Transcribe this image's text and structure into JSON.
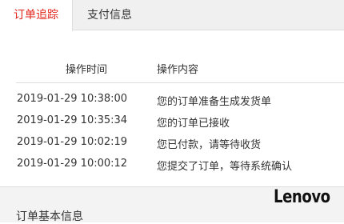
{
  "tabs": [
    {
      "label": "订单追踪",
      "active": true
    },
    {
      "label": "支付信息",
      "active": false
    }
  ],
  "tracking_table": {
    "headers": {
      "time": "操作时间",
      "content": "操作内容"
    },
    "rows": [
      {
        "time": "2019-01-29 10:38:00",
        "content": "您的订单准备生成发货单"
      },
      {
        "time": "2019-01-29 10:35:34",
        "content": "您的订单已接收"
      },
      {
        "time": "2019-01-29 10:02:19",
        "content": "您已付款，请等待收货"
      },
      {
        "time": "2019-01-29 10:00:12",
        "content": "您提交了订单，等待系统确认"
      }
    ]
  },
  "section": {
    "title": "订单基本信息"
  },
  "watermark": {
    "text": "Lenovo"
  },
  "colors": {
    "active_tab": "#e2231a",
    "tab_bar_bg": "#f0f0f0",
    "section_bg": "#f3f3f3"
  }
}
